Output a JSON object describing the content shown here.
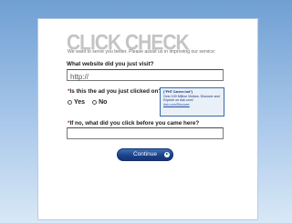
{
  "brand": {
    "logo_text": "CLICK CHECK",
    "tagline": "We want to serve you better. Please assist us in improving our service:"
  },
  "questions": {
    "q1": {
      "label": "What website did you just visit?",
      "value": "http://"
    },
    "q2": {
      "required_mark": "*",
      "label": "Is this the ad you just clicked on?",
      "yes": "Yes",
      "no": "No"
    },
    "q3": {
      "required_mark": "*",
      "label": "If no, what did you click before you came here?",
      "value": ""
    }
  },
  "ad_preview": {
    "title": "(\"FHT Career-hot\")",
    "body": "Over 100 Million Visitors. Discover and Explore on Ask.com!",
    "link": "Ask.com/Discover"
  },
  "actions": {
    "continue_label": "Continue"
  },
  "colors": {
    "accent": "#1a3f86",
    "required": "#c62828",
    "logo": "#c4c4c4"
  }
}
